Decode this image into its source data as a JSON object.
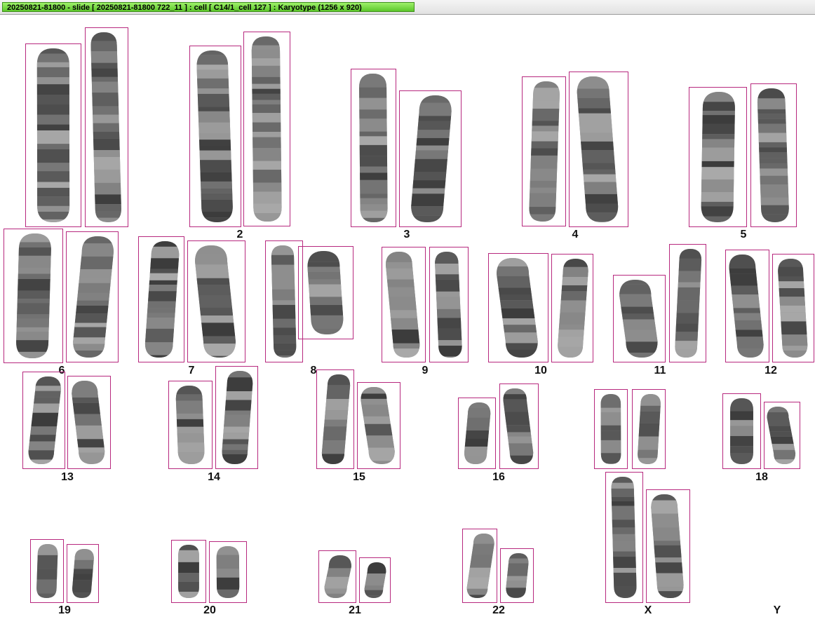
{
  "window": {
    "title": "20250821-81800 - slide [ 20250821-81800 722_11 ] : cell [ C14/1_cell 127 ] : Karyotype  (1256 x 920)"
  },
  "karyotype": {
    "labels": {
      "c2": "2",
      "c3": "3",
      "c4": "4",
      "c5": "5",
      "c6": "6",
      "c7": "7",
      "c8": "8",
      "c9": "9",
      "c10": "10",
      "c11": "11",
      "c12": "12",
      "c13": "13",
      "c14": "14",
      "c15": "15",
      "c16": "16",
      "c18": "18",
      "c19": "19",
      "c20": "20",
      "c21": "21",
      "c22": "22",
      "cX": "X",
      "cY": "Y"
    }
  }
}
